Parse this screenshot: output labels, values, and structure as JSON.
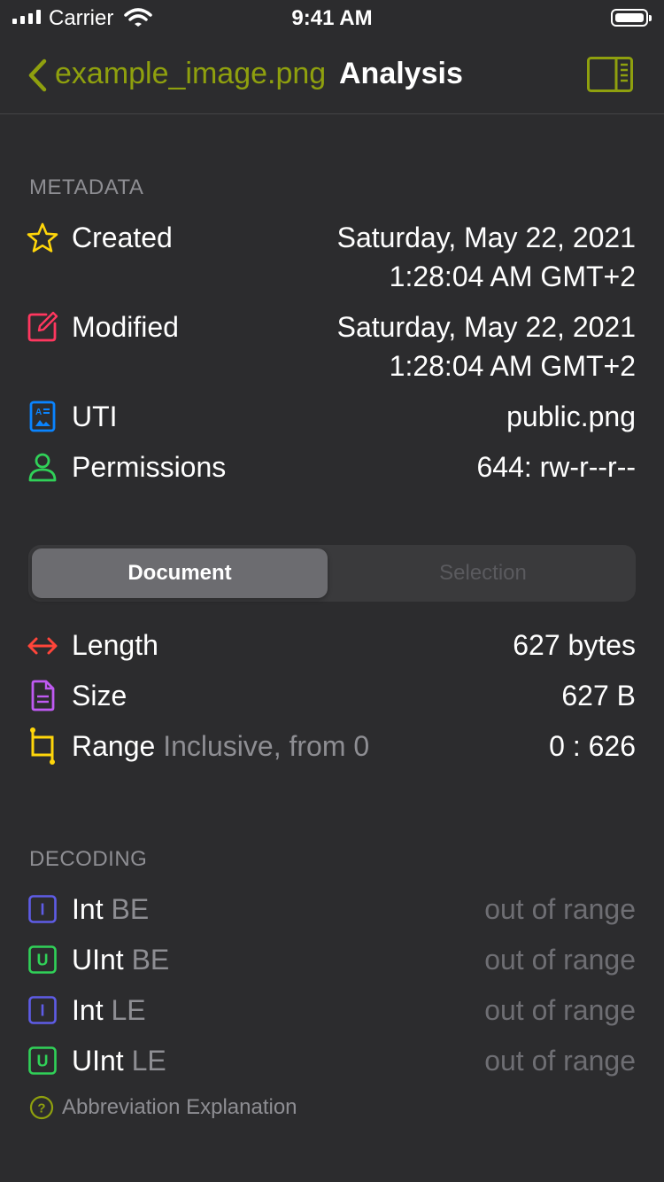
{
  "status_bar": {
    "carrier": "Carrier",
    "time": "9:41 AM"
  },
  "nav": {
    "back_label": "example_image.png",
    "title": "Analysis",
    "accent_color": "#8fa00e"
  },
  "metadata": {
    "header": "METADATA",
    "created": {
      "label": "Created",
      "value_line1": "Saturday, May 22, 2021",
      "value_line2": "1:28:04 AM GMT+2",
      "icon": "star-icon",
      "color": "#ffd60a"
    },
    "modified": {
      "label": "Modified",
      "value_line1": "Saturday, May 22, 2021",
      "value_line2": "1:28:04 AM GMT+2",
      "icon": "edit-icon",
      "color": "#ff375f"
    },
    "uti": {
      "label": "UTI",
      "value": "public.png",
      "icon": "document-image-icon",
      "color": "#0a84ff"
    },
    "permissions": {
      "label": "Permissions",
      "value": "644: rw-r--r--",
      "icon": "person-icon",
      "color": "#30d158"
    }
  },
  "segmented": {
    "options": [
      "Document",
      "Selection"
    ],
    "selected": "Document"
  },
  "document": {
    "length": {
      "label": "Length",
      "value": "627 bytes",
      "icon": "arrows-horizontal-icon",
      "color": "#ff453a"
    },
    "size": {
      "label": "Size",
      "value": "627 B",
      "icon": "document-text-icon",
      "color": "#bf5af2"
    },
    "range": {
      "label": "Range",
      "sublabel": "Inclusive, from 0",
      "value": "0 : 626",
      "icon": "crop-icon",
      "color": "#ffd60a"
    }
  },
  "decoding": {
    "header": "DECODING",
    "rows": [
      {
        "label": "Int",
        "sublabel": "BE",
        "value": "out of range",
        "badge": "I",
        "icon": "int-badge-icon",
        "color": "#5e5ce6"
      },
      {
        "label": "UInt",
        "sublabel": "BE",
        "value": "out of range",
        "badge": "U",
        "icon": "uint-badge-icon",
        "color": "#30d158"
      },
      {
        "label": "Int",
        "sublabel": "LE",
        "value": "out of range",
        "badge": "I",
        "icon": "int-badge-icon",
        "color": "#5e5ce6"
      },
      {
        "label": "UInt",
        "sublabel": "LE",
        "value": "out of range",
        "badge": "U",
        "icon": "uint-badge-icon",
        "color": "#30d158"
      }
    ],
    "footnote": "Abbreviation Explanation"
  }
}
